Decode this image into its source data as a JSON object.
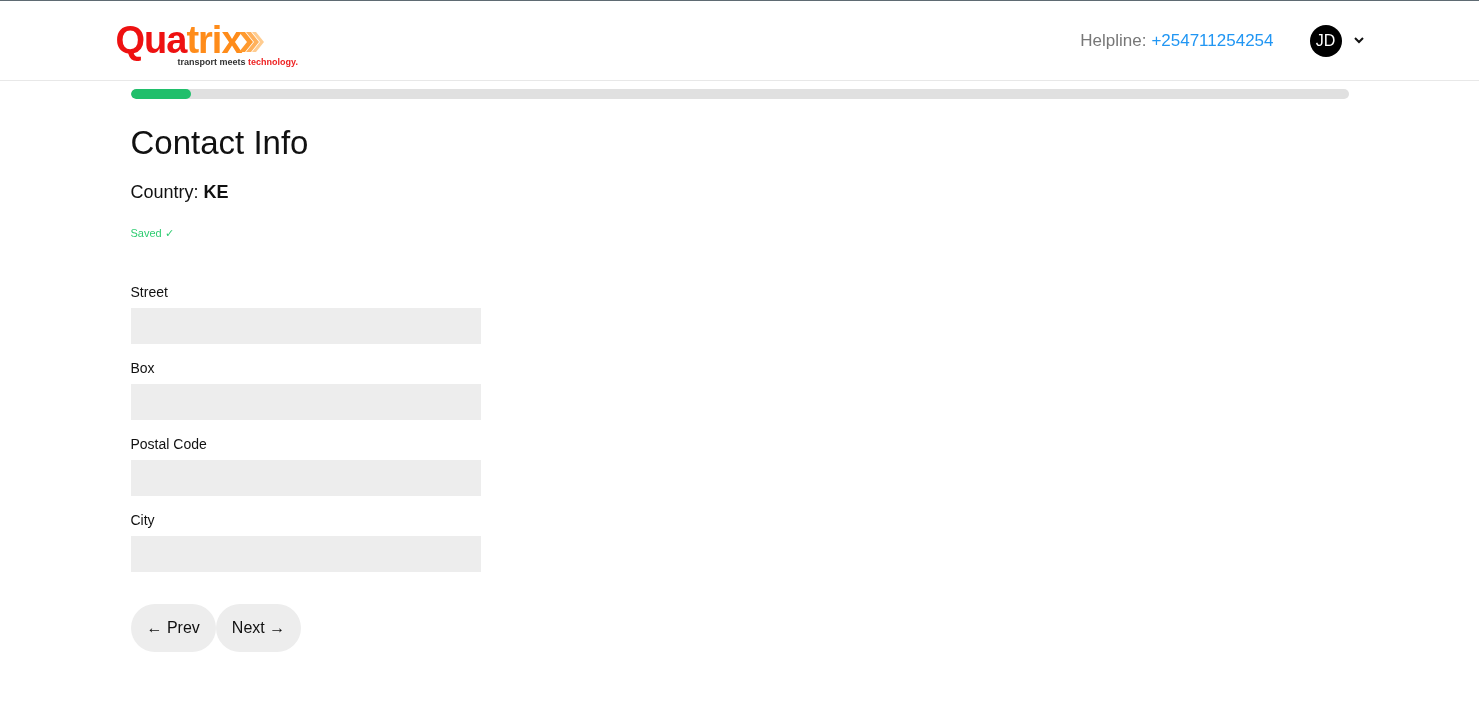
{
  "header": {
    "logo": {
      "wordmark": [
        "Qua",
        "trix"
      ],
      "tagline": [
        "transport meets",
        "technology."
      ]
    },
    "helpline": {
      "label": "Helpline:",
      "number": "+254711254254"
    },
    "user": {
      "initials": "JD"
    }
  },
  "progress": {
    "level": 0.05
  },
  "title": "Contact Info",
  "country": "Country: **KE**",
  "status": "Saved ✓",
  "fields": [
    {
      "label": "Street"
    },
    {
      "label": "Box"
    },
    {
      "label": "Postal Code"
    },
    {
      "label": "City"
    }
  ],
  "buttons": [
    {
      "label": "← Prev"
    },
    {
      "label": "Next →"
    }
  ]
}
